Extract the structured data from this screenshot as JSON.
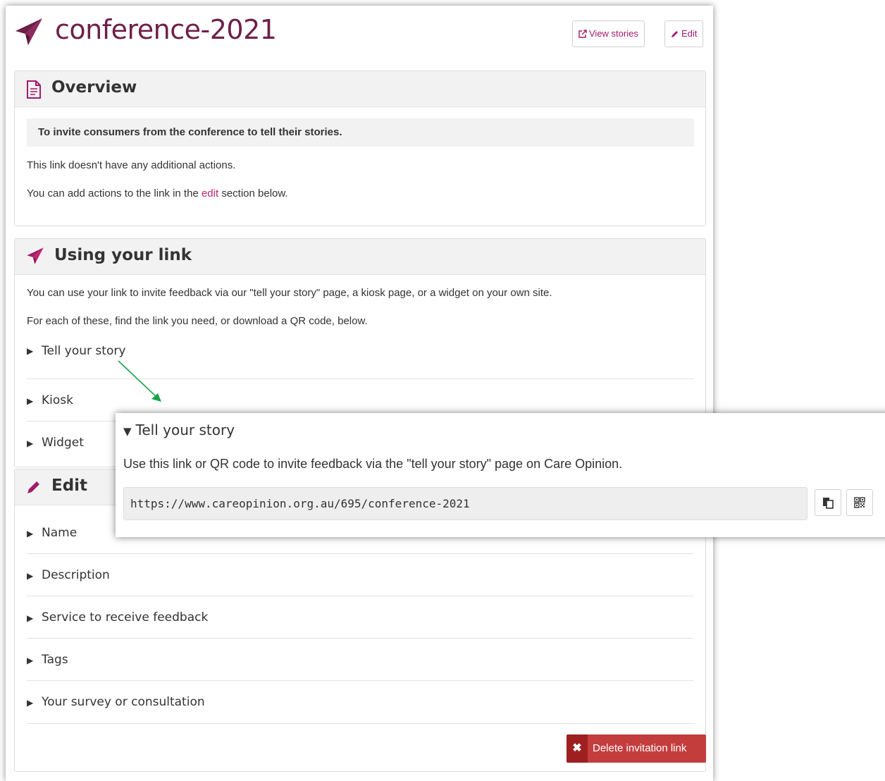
{
  "header": {
    "title": "conference-2021",
    "view_stories_label": "View stories",
    "edit_label": "Edit"
  },
  "overview": {
    "title": "Overview",
    "callout": "To invite consumers from the conference to tell their stories.",
    "line1": "This link doesn't have any additional actions.",
    "line2_before": "You can add actions to the link in the",
    "line2_link": "edit",
    "line2_after": "section below."
  },
  "using": {
    "title": "Using your link",
    "line1": "You can use your link to invite feedback via our \"tell your story\" page, a kiosk page, or a widget on your own site.",
    "line2": "For each of these, find the link you need, or download a QR code, below.",
    "items": [
      "Tell your story",
      "Kiosk",
      "Widget"
    ]
  },
  "edit": {
    "title": "Edit",
    "items": [
      "Name",
      "Description",
      "Service to receive feedback",
      "Tags",
      "Your survey or consultation"
    ],
    "delete_label": "Delete invitation link"
  },
  "zoom": {
    "title": "Tell your story",
    "description": "Use this link or QR code to invite feedback via the \"tell your story\" page on Care Opinion.",
    "url": "https://www.careopinion.org.au/695/conference-2021"
  },
  "icons": {
    "brand": "paper-plane-icon",
    "external": "external-link-icon",
    "pencil": "pencil-icon",
    "document": "document-icon",
    "copy": "copy-icon",
    "qr": "qr-code-icon",
    "collapsed": "triangle-right-icon",
    "expanded": "triangle-down-icon",
    "delete": "close-icon"
  },
  "colors": {
    "brand": "#6e2049",
    "accent": "#a3196b",
    "link": "#c2256e",
    "danger": "#c43d3d",
    "annotation_arrow": "#1aa34a"
  }
}
